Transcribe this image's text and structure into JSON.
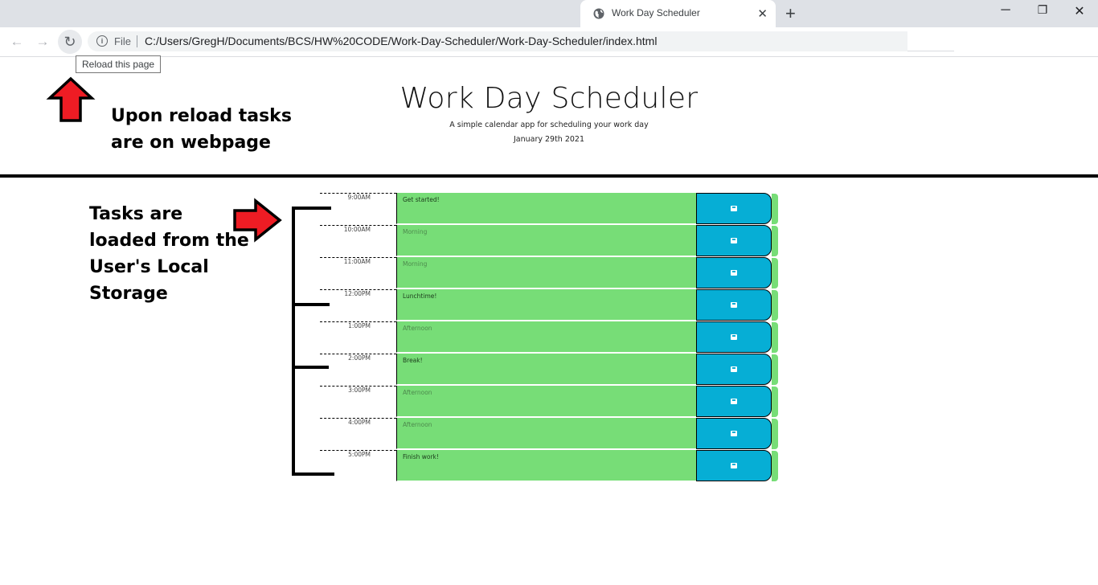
{
  "browser": {
    "tab_title": "Work Day Scheduler",
    "tab_close": "✕",
    "new_tab": "+",
    "window_controls": {
      "minimize": "─",
      "maximize": "❐",
      "close": "✕"
    },
    "nav": {
      "back": "←",
      "forward": "→",
      "reload": "↻"
    },
    "address": {
      "scheme_label": "File",
      "url": "C:/Users/GregH/Documents/BCS/HW%20CODE/Work-Day-Scheduler/Work-Day-Scheduler/index.html"
    },
    "tooltip": "Reload this page",
    "icons": {
      "favicon": "globe-icon",
      "info": "info-icon"
    }
  },
  "header": {
    "title": "Work Day Scheduler",
    "subtitle": "A simple calendar app for scheduling your work day",
    "date": "January 29th 2021"
  },
  "schedule": {
    "rows": [
      {
        "hour": "9:00AM",
        "text": "Get started!",
        "placeholder": false
      },
      {
        "hour": "10:00AM",
        "text": "Morning",
        "placeholder": true
      },
      {
        "hour": "11:00AM",
        "text": "Morning",
        "placeholder": true
      },
      {
        "hour": "12:00PM",
        "text": "Lunchtime!",
        "placeholder": false
      },
      {
        "hour": "1:00PM",
        "text": "Afternoon",
        "placeholder": true
      },
      {
        "hour": "2:00PM",
        "text": "Break!",
        "placeholder": false
      },
      {
        "hour": "3:00PM",
        "text": "Afternoon",
        "placeholder": true
      },
      {
        "hour": "4:00PM",
        "text": "Afternoon",
        "placeholder": true
      },
      {
        "hour": "5:00PM",
        "text": "Finish work!",
        "placeholder": false
      }
    ],
    "colors": {
      "future": "#77dd77",
      "save_button": "#06aed5"
    },
    "save_icon": "save-icon"
  },
  "annotations": {
    "reload_note": "Upon reload tasks are on webpage",
    "storage_note": "Tasks are loaded from the User's Local Storage",
    "arrow_color": "#ee1c24"
  }
}
